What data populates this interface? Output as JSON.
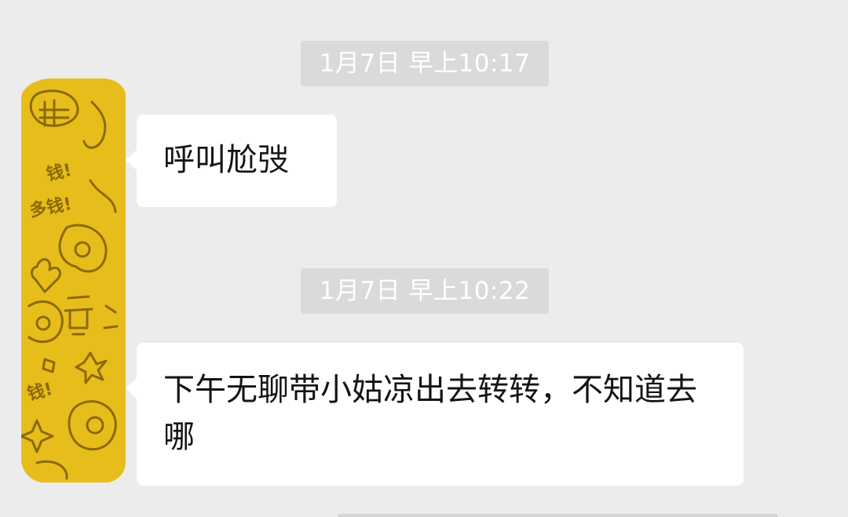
{
  "messages": [
    {
      "timestamp": "1月7日 早上10:17",
      "text": "呼叫尬弢"
    },
    {
      "timestamp": "1月7日 早上10:22",
      "text": "下午无聊带小姑凉出去转转，不知道去哪"
    }
  ],
  "avatar": {
    "icon": "doodle-avatar-icon",
    "color": "#e9bf1f",
    "sticker_text": [
      "钱!",
      "多钱!",
      "钱!"
    ]
  },
  "colors": {
    "background": "#ececec",
    "bubble": "#ffffff",
    "timestamp_bg": "#dadada"
  }
}
